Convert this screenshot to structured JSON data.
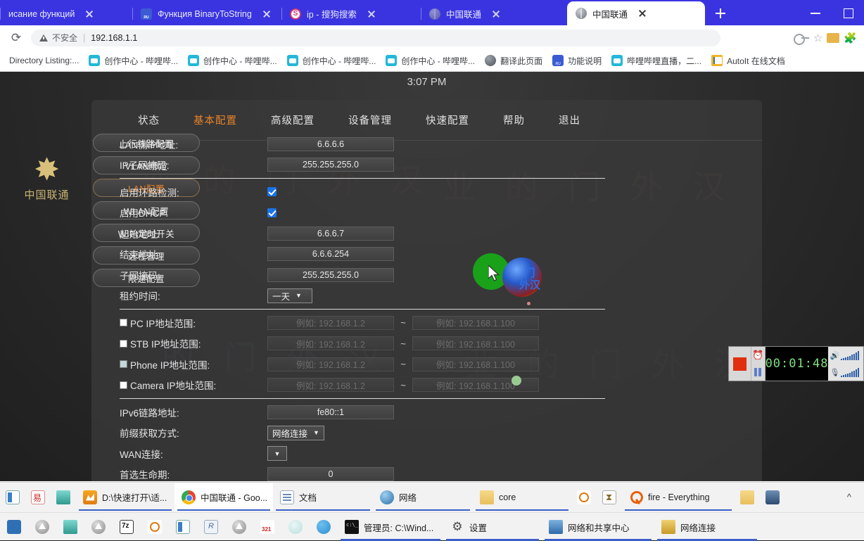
{
  "browser": {
    "tabs": [
      {
        "title": "исание функций",
        "favicon": "none",
        "active": false,
        "close_icon": "close-icon"
      },
      {
        "title": "Функция BinaryToString",
        "favicon": "ru-icon",
        "active": false,
        "close_icon": "close-icon"
      },
      {
        "title": "ip - 搜狗搜索",
        "favicon": "sogou-icon",
        "active": false,
        "close_icon": "close-icon"
      },
      {
        "title": "中国联通",
        "favicon": "globe-icon",
        "active": false,
        "close_icon": "close-icon"
      },
      {
        "title": "中国联通",
        "favicon": "globe-icon",
        "active": true,
        "close_icon": "close-icon"
      }
    ],
    "new_tab_label": "+",
    "window_minimize": "minimize-icon",
    "window_maximize": "maximize-icon",
    "toolbar": {
      "reload_icon": "reload-icon",
      "security_label": "不安全",
      "url": "192.168.1.1",
      "password_key_icon": "key-icon",
      "bookmark_star_icon": "star-icon",
      "extension_cat_icon": "cat-extension-icon",
      "extensions_icon": "puzzle-icon"
    },
    "bookmarks": [
      {
        "label": "Directory Listing:...",
        "icon": "none"
      },
      {
        "label": "创作中心 - 哔哩哔...",
        "icon": "bilibili-icon"
      },
      {
        "label": "创作中心 - 哔哩哔...",
        "icon": "bilibili-icon"
      },
      {
        "label": "创作中心 - 哔哩哔...",
        "icon": "bilibili-icon"
      },
      {
        "label": "创作中心 - 哔哩哔...",
        "icon": "bilibili-icon"
      },
      {
        "label": "翻译此页面",
        "icon": "globe-icon"
      },
      {
        "label": "功能说明",
        "icon": "ru-icon"
      },
      {
        "label": "哔哩哔哩直播，二...",
        "icon": "bilibili-icon"
      },
      {
        "label": "AutoIt 在线文档",
        "icon": "autoit-icon"
      }
    ]
  },
  "router": {
    "clock": "3:07 PM",
    "brand": {
      "glyph": "中国联通-logo",
      "text": "中国联通"
    },
    "watermarks": [
      "业 的 门 外 汉",
      "业 的 门 外 汉",
      "的 门 外 汉",
      "业 的 门 外 汉"
    ],
    "topnav": [
      {
        "label": "状态",
        "active": false
      },
      {
        "label": "基本配置",
        "active": true
      },
      {
        "label": "高级配置",
        "active": false
      },
      {
        "label": "设备管理",
        "active": false
      },
      {
        "label": "快速配置",
        "active": false
      },
      {
        "label": "帮助",
        "active": false
      },
      {
        "label": "退出",
        "active": false
      }
    ],
    "sidebar": [
      {
        "label": "上行线路配置",
        "active": false
      },
      {
        "label": "VLAN绑定",
        "active": false
      },
      {
        "label": "LAN配置",
        "active": true
      },
      {
        "label": "WLAN配置",
        "active": false
      },
      {
        "label": "WIFI定时开关",
        "active": false
      },
      {
        "label": "远程管理",
        "active": false
      },
      {
        "label": "限速配置",
        "active": false
      }
    ],
    "form": {
      "lan_ip_label": "LAN侧IP地址:",
      "lan_ip_value": "6.6.6.6",
      "subnet_mask_label": "IP子网掩码:",
      "subnet_mask_value": "255.255.255.0",
      "loop_detect_label": "启用环路检测:",
      "loop_detect_checked": true,
      "dhcp_label": "启用DHCP:",
      "dhcp_checked": true,
      "start_addr_label": "起始地址:",
      "start_addr_value": "6.6.6.7",
      "end_addr_label": "结束地址:",
      "end_addr_value": "6.6.6.254",
      "dhcp_mask_label": "子网掩码:",
      "dhcp_mask_value": "255.255.255.0",
      "lease_label": "租约时间:",
      "lease_value": "一天",
      "ranges": [
        {
          "label": "PC IP地址范围:",
          "checked": false,
          "from_placeholder": "例如: 192.168.1.2",
          "to_placeholder": "例如: 192.168.1.100",
          "separator": "~"
        },
        {
          "label": "STB IP地址范围:",
          "checked": false,
          "from_placeholder": "例如: 192.168.1.2",
          "to_placeholder": "例如: 192.168.1.100",
          "separator": "~"
        },
        {
          "label": "Phone IP地址范围:",
          "checked": false,
          "from_placeholder": "例如: 192.168.1.2",
          "to_placeholder": "例如: 192.168.1.100",
          "separator": "~"
        },
        {
          "label": "Camera IP地址范围:",
          "checked": false,
          "from_placeholder": "例如: 192.168.1.2",
          "to_placeholder": "例如: 192.168.1.100",
          "separator": "~"
        }
      ],
      "ipv6_link_label": "IPv6链路地址:",
      "ipv6_link_value": "fe80::1",
      "prefix_mode_label": "前缀获取方式:",
      "prefix_mode_value": "网络连接",
      "wan_conn_label": "WAN连接:",
      "wan_conn_value": "",
      "preferred_life_label": "首选生命期:",
      "preferred_life_value": "0"
    },
    "decor": {
      "ball_text_line1": "门",
      "ball_text_line2": "外汉"
    }
  },
  "recorder": {
    "stop_icon": "stop-icon",
    "alarm_icon": "alarm-clock-icon",
    "pause_icon": "pause-icon",
    "time": "00:01:48",
    "speaker_icon": "speaker-icon",
    "microphone_icon": "microphone-icon"
  },
  "taskbar": {
    "row1": [
      {
        "label": "",
        "icon": "taskview-icon",
        "open": false
      },
      {
        "label": "",
        "icon": "red-seal-icon",
        "open": false
      },
      {
        "label": "",
        "icon": "teal-app-icon",
        "open": false
      },
      {
        "label": "D:\\快速打开\\适...",
        "icon": "folder-orange-icon",
        "open": true
      },
      {
        "label": "中国联通 - Goo...",
        "icon": "chrome-icon",
        "open": true,
        "active": true
      },
      {
        "label": "文档",
        "icon": "document-icon",
        "open": true
      },
      {
        "label": "网络",
        "icon": "network-icon",
        "open": true
      },
      {
        "label": "core",
        "icon": "folder-icon",
        "open": true
      },
      {
        "label": "",
        "icon": "search-file-icon",
        "open": false
      },
      {
        "label": "",
        "icon": "hourglass-icon",
        "open": false
      },
      {
        "label": "fire - Everything",
        "icon": "everything-icon",
        "open": true
      },
      {
        "label": "",
        "icon": "folder-small-icon",
        "open": false
      },
      {
        "label": "",
        "icon": "image-viewer-icon",
        "open": false
      }
    ],
    "row2": [
      {
        "label": "",
        "icon": "user-app-icon",
        "open": false
      },
      {
        "label": "",
        "icon": "media-player-icon",
        "open": false
      },
      {
        "label": "",
        "icon": "notepad-icon",
        "open": false
      },
      {
        "label": "",
        "icon": "media-player-icon",
        "open": false
      },
      {
        "label": "",
        "icon": "sevenzip-icon",
        "open": false
      },
      {
        "label": "",
        "icon": "snipping-icon",
        "open": false
      },
      {
        "label": "",
        "icon": "panel-icon",
        "open": false
      },
      {
        "label": "",
        "icon": "revo-icon",
        "open": false
      },
      {
        "label": "",
        "icon": "media-player-icon",
        "open": false
      },
      {
        "label": "",
        "icon": "calendar-321-icon",
        "open": false
      },
      {
        "label": "",
        "icon": "atom-icon",
        "open": false
      },
      {
        "label": "",
        "icon": "telegram-icon",
        "open": false
      },
      {
        "label": "管理员: C:\\Wind...",
        "icon": "cmd-icon",
        "open": true
      },
      {
        "label": "设置",
        "icon": "settings-gear-icon",
        "open": true
      },
      {
        "label": "网络和共享中心",
        "icon": "network-share-icon",
        "open": true
      },
      {
        "label": "网络连接",
        "icon": "network-connections-icon",
        "open": true
      }
    ],
    "tray_chevron": "chevron-up-icon"
  }
}
